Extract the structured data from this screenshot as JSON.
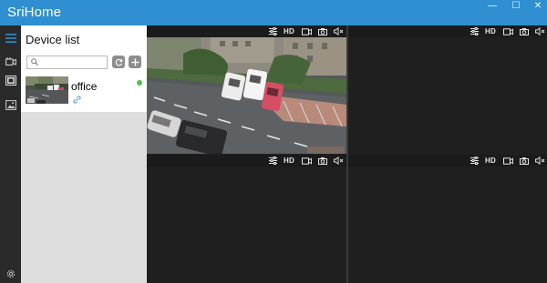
{
  "app": {
    "title": "SriHome"
  },
  "window_controls": {
    "minimize": "—",
    "maximize": "☐",
    "close": "✕"
  },
  "nav": {
    "items": [
      "menu",
      "video-camera",
      "playback",
      "gallery"
    ],
    "bottom": "settings"
  },
  "device_panel": {
    "title": "Device list",
    "search_placeholder": "",
    "devices": [
      {
        "name": "office",
        "status": "online"
      }
    ]
  },
  "toolbar": {
    "hd_label": "HD"
  },
  "colors": {
    "titlebar": "#2f8fd0",
    "online": "#4cc04c",
    "sidebar_bg": "#dedede",
    "pane_bg": "#1f1f1f"
  }
}
